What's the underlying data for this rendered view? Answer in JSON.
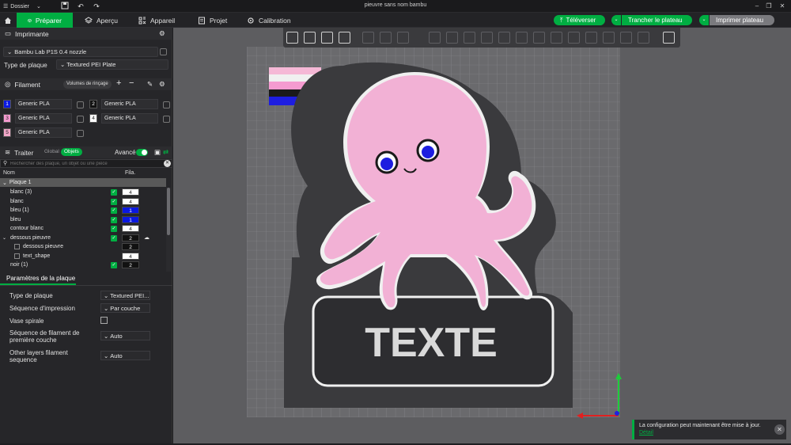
{
  "window": {
    "title": "pieuvre sans nom bambu",
    "menu_label": "Dossier"
  },
  "toolbar": {
    "tabs": [
      {
        "label": "Préparer",
        "icon": "cube-icon",
        "active": true
      },
      {
        "label": "Aperçu",
        "icon": "layers-icon"
      },
      {
        "label": "Appareil",
        "icon": "device-icon"
      },
      {
        "label": "Projet",
        "icon": "project-icon"
      },
      {
        "label": "Calibration",
        "icon": "calibration-icon"
      }
    ],
    "upload_label": "Téléverser",
    "slice_label": "Trancher le plateau",
    "print_label": "Imprimer plateau"
  },
  "printer": {
    "section_label": "Imprimante",
    "name": "Bambu Lab P1S 0.4 nozzle",
    "plate_type_label": "Type de plaque",
    "plate_type_value": "Textured PEI Plate"
  },
  "filament": {
    "section_label": "Filament",
    "flush_label": "Volumes de rinçage",
    "items": [
      {
        "num": "1",
        "name": "Generic PLA",
        "color": "#0a18e0",
        "text_color": "#ffffff"
      },
      {
        "num": "2",
        "name": "Generic PLA",
        "color": "#111111",
        "text_color": "#ffffff"
      },
      {
        "num": "3",
        "name": "Generic PLA",
        "color": "#f59bd0",
        "text_color": "#222222"
      },
      {
        "num": "4",
        "name": "Generic PLA",
        "color": "#ffffff",
        "text_color": "#222222"
      },
      {
        "num": "5",
        "name": "Generic PLA",
        "color": "#f2a7c8",
        "text_color": "#222222"
      }
    ]
  },
  "process": {
    "section_label": "Traiter",
    "global_label": "Global",
    "objects_label": "Objets",
    "advanced_label": "Avancé",
    "search_placeholder": "Rechercher des plaque, un objet ou une pièce",
    "col_name": "Nom",
    "col_fila": "Fila.",
    "plate_row": "Plaque 1",
    "objects": [
      {
        "name": "blanc (3)",
        "fila": "4",
        "indent": 1,
        "checked": true,
        "fill": "#ffffff",
        "text": "#222"
      },
      {
        "name": "blanc",
        "fila": "4",
        "indent": 1,
        "checked": true,
        "fill": "#ffffff",
        "text": "#222"
      },
      {
        "name": "bleu (1)",
        "fila": "1",
        "indent": 1,
        "checked": true,
        "fill": "#0a18e0",
        "text": "#fff"
      },
      {
        "name": "bleu",
        "fila": "1",
        "indent": 1,
        "checked": true,
        "fill": "#0a18e0",
        "text": "#fff"
      },
      {
        "name": "contour blanc",
        "fila": "4",
        "indent": 1,
        "checked": true,
        "fill": "#ffffff",
        "text": "#222"
      },
      {
        "name": "dessous pieuvre",
        "fila": "2",
        "indent": 1,
        "checked": true,
        "fill": "#111111",
        "text": "#fff",
        "expanded": true
      },
      {
        "name": "dessous pieuvre",
        "fila": "2",
        "indent": 2,
        "checked": false,
        "fill": "#111111",
        "text": "#fff"
      },
      {
        "name": "text_shape",
        "fila": "4",
        "indent": 2,
        "checked": false,
        "fill": "#ffffff",
        "text": "#222"
      },
      {
        "name": "noir (1)",
        "fila": "2",
        "indent": 1,
        "checked": true,
        "fill": "#111111",
        "text": "#fff"
      }
    ]
  },
  "plate_params": {
    "tab_label": "Paramètres de la plaque",
    "rows": [
      {
        "label": "Type de plaque",
        "value": "Textured PEI..."
      },
      {
        "label": "Séquence d'impression",
        "value": "Par couche"
      },
      {
        "label": "Vase spirale",
        "value": ""
      },
      {
        "label": "Séquence de filament de première couche",
        "value": "Auto"
      },
      {
        "label": "Other layers filament sequence",
        "value": "Auto"
      }
    ]
  },
  "model": {
    "text": "TEXTE"
  },
  "notification": {
    "message": "La configuration peut maintenant être mise à jour.",
    "link": "Détail"
  }
}
